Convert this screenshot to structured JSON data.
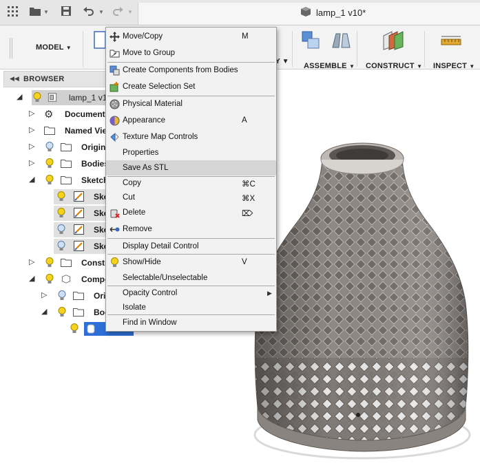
{
  "titlebar": {
    "document_title": "lamp_1 v10*",
    "icons": [
      "grid-icon",
      "folder-icon",
      "save-icon",
      "undo-icon",
      "redo-icon"
    ]
  },
  "toolbar": {
    "workspace": "MODEL",
    "groups": [
      {
        "label": "ASSEMBLE"
      },
      {
        "label": "CONSTRUCT"
      },
      {
        "label": "INSPECT"
      }
    ]
  },
  "browser": {
    "title": "BROWSER",
    "rows": [
      {
        "label": "lamp_1 v1"
      },
      {
        "label": "Document S"
      },
      {
        "label": "Named View"
      },
      {
        "label": "Origin"
      },
      {
        "label": "Bodies"
      },
      {
        "label": "Sketch"
      },
      {
        "label": "Ske"
      },
      {
        "label": "Ske"
      },
      {
        "label": "Ske"
      },
      {
        "label": "Ske"
      },
      {
        "label": "Constr"
      },
      {
        "label": "Compo"
      },
      {
        "label": "Ori"
      },
      {
        "label": "Bod"
      }
    ]
  },
  "context_menu": {
    "items": [
      {
        "label": "Move/Copy",
        "shortcut": "M",
        "icon": "move-icon"
      },
      {
        "label": "Move to Group",
        "shortcut": "",
        "icon": "group-icon"
      },
      {
        "label": "Create Components from Bodies",
        "shortcut": "",
        "icon": "components-icon"
      },
      {
        "label": "Create Selection Set",
        "shortcut": "",
        "icon": "selection-set-icon"
      },
      {
        "label": "Physical Material",
        "shortcut": "",
        "icon": "material-icon"
      },
      {
        "label": "Appearance",
        "shortcut": "A",
        "icon": "appearance-icon"
      },
      {
        "label": "Texture Map Controls",
        "shortcut": "",
        "icon": "texture-icon"
      },
      {
        "label": "Properties",
        "shortcut": "",
        "icon": ""
      },
      {
        "label": "Save As STL",
        "shortcut": "",
        "icon": "",
        "highlighted": true
      },
      {
        "label": "Copy",
        "shortcut": "⌘C",
        "icon": ""
      },
      {
        "label": "Cut",
        "shortcut": "⌘X",
        "icon": ""
      },
      {
        "label": "Delete",
        "shortcut": "⌦",
        "icon": "delete-icon"
      },
      {
        "label": "Remove",
        "shortcut": "",
        "icon": "remove-icon"
      },
      {
        "label": "Display Detail Control",
        "shortcut": "",
        "icon": ""
      },
      {
        "label": "Show/Hide",
        "shortcut": "V",
        "icon": "lightbulb-icon"
      },
      {
        "label": "Selectable/Unselectable",
        "shortcut": "",
        "icon": ""
      },
      {
        "label": "Opacity Control",
        "shortcut": "",
        "icon": "",
        "submenu": true
      },
      {
        "label": "Isolate",
        "shortcut": "",
        "icon": ""
      },
      {
        "label": "Find in Window",
        "shortcut": "",
        "icon": ""
      }
    ]
  },
  "colors": {
    "menu_highlight": "#d5d5d5",
    "selection_blue": "#2d6fd6",
    "lamp_body": "#8c8682"
  }
}
